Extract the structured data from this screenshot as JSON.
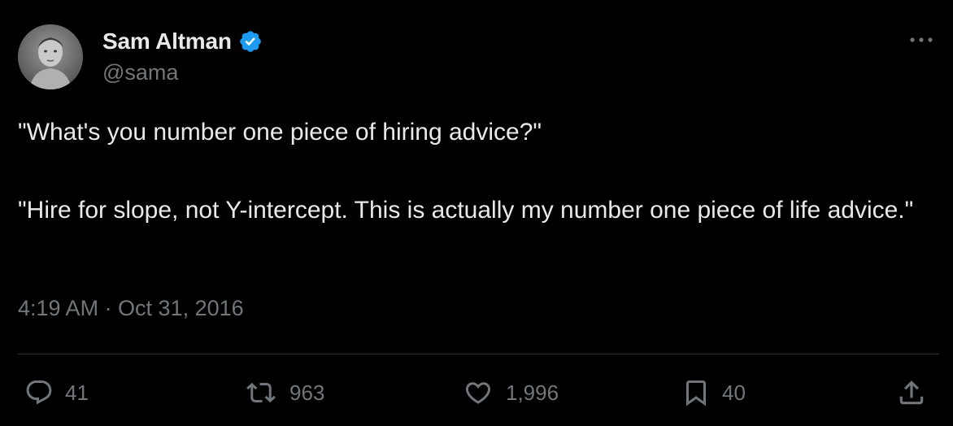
{
  "author": {
    "name": "Sam Altman",
    "handle": "@sama",
    "verified": true,
    "verified_color": "#1d9bf0"
  },
  "tweet": {
    "paragraphs": [
      "\"What's you number one piece of hiring advice?\"",
      "\"Hire for slope, not Y-intercept. This is actually my number one piece of life advice.\""
    ],
    "timestamp": "4:19 AM · Oct 31, 2016"
  },
  "actions": {
    "replies": "41",
    "retweets": "963",
    "likes": "1,996",
    "bookmarks": "40"
  },
  "icons": {
    "more": "more-horizontal-icon",
    "reply": "reply-icon",
    "retweet": "retweet-icon",
    "like": "heart-icon",
    "bookmark": "bookmark-icon",
    "share": "share-icon"
  },
  "colors": {
    "background": "#000000",
    "text_primary": "#e7e9ea",
    "text_secondary": "#71767b",
    "divider": "#2f3336"
  }
}
